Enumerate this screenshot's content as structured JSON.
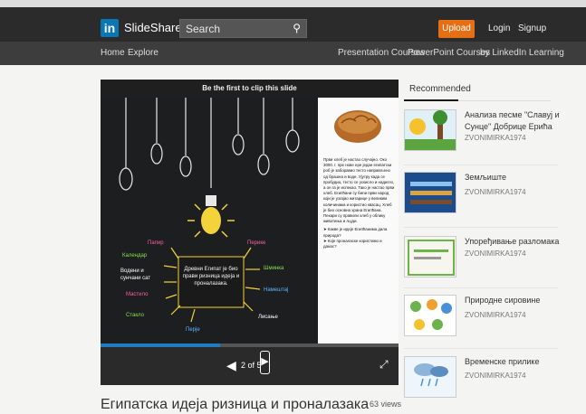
{
  "header": {
    "logo_letters": "in",
    "logo_text": "SlideShare",
    "search_placeholder": "Search",
    "upload_label": "Upload",
    "login_label": "Login",
    "signup_label": "Signup"
  },
  "nav": {
    "home": "Home",
    "explore": "Explore",
    "presentation_courses": "Presentation Courses",
    "powerpoint_courses": "PowerPoint Courses",
    "by_linkedin": "by LinkedIn Learning"
  },
  "player": {
    "clip_text": "Be the first to clip this slide",
    "page_indicator": "2 of 5",
    "progress_fraction": 0.4,
    "slide": {
      "center_text": "Древни Египат је био прави ризница идеја и проналазака.",
      "left_words": [
        "Папир",
        "Календар",
        "Водени и сунчани сат",
        "Мастило",
        "Стакло",
        "Перје"
      ],
      "right_words": [
        "Перике",
        "Шминка",
        "Намештај",
        "Лисање"
      ],
      "paper_text": "Први хлеб је настао случајно. Око 3000. г. пре нове ере један египатски роб је заборавио тесто направљено од брашна и воде. Ујутру када се пробудио, тесто се ускисло и надигло, а он га је испекао. Тако је настао први хлеб. Египћани су били први народ који је узгајао житарице у великим количинама и користио квасац. Хлеб је био основна храна Египћана. Пекари су правили хлеб у облику животиња и људи.",
      "bullet_1": "Какве је идеје Египћанима дала природа?",
      "bullet_2": "Које проналаске користимо и данас?"
    }
  },
  "main": {
    "title": "Египатска идеја ризница и проналазака",
    "views": "63 views"
  },
  "recommended": {
    "header": "Recommended",
    "items": [
      {
        "title": "Анализа песме \"Славуј и Сунце\" Добрице Ерића",
        "author": "ZVONIMIRKA1974"
      },
      {
        "title": "Земљиште",
        "author": "ZVONIMIRKA1974"
      },
      {
        "title": "Упоређивање разломака",
        "author": "ZVONIMIRKA1974"
      },
      {
        "title": "Природне сировине",
        "author": "ZVONIMIRKA1974"
      },
      {
        "title": "Временске прилике",
        "author": "ZVONIMIRKA1974"
      }
    ]
  },
  "colors": {
    "header_bg": "#2b2b2b",
    "nav_bg": "#3d3d3d",
    "upload": "#e46f15",
    "linkedin_blue": "#0a76b4",
    "progress": "#1e7cbf"
  }
}
